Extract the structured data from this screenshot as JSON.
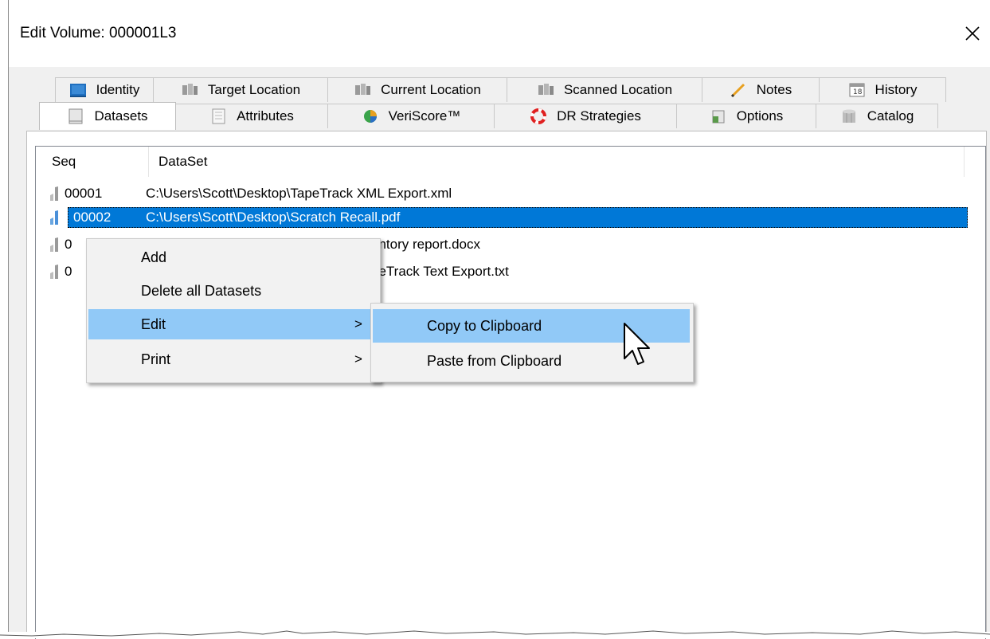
{
  "window": {
    "title": "Edit Volume: 000001L3"
  },
  "tabs_back": [
    {
      "label": "Identity",
      "icon": "identity-icon"
    },
    {
      "label": "Target Location",
      "icon": "target-location-icon"
    },
    {
      "label": "Current Location",
      "icon": "current-location-icon"
    },
    {
      "label": "Scanned Location",
      "icon": "scanned-location-icon"
    },
    {
      "label": "Notes",
      "icon": "pencil-icon"
    },
    {
      "label": "History",
      "icon": "calendar-icon"
    }
  ],
  "tabs_front": [
    {
      "label": "Datasets",
      "icon": "datasets-icon",
      "selected": true
    },
    {
      "label": "Attributes",
      "icon": "attributes-icon"
    },
    {
      "label": "VeriScore™",
      "icon": "veriscore-icon"
    },
    {
      "label": "DR Strategies",
      "icon": "lifebuoy-icon"
    },
    {
      "label": "Options",
      "icon": "options-icon"
    },
    {
      "label": "Catalog",
      "icon": "database-icon"
    }
  ],
  "list": {
    "columns": [
      "Seq",
      "DataSet"
    ],
    "rows": [
      {
        "seq": "00001",
        "path": "C:\\Users\\Scott\\Desktop\\TapeTrack XML Export.xml"
      },
      {
        "seq": "00002",
        "path": "C:\\Users\\Scott\\Desktop\\Scratch Recall.pdf",
        "selected": true
      },
      {
        "seq": "0",
        "path": "entory report.docx"
      },
      {
        "seq": "0",
        "path": "peTrack Text Export.txt"
      }
    ]
  },
  "context_menu": {
    "items": [
      "Add",
      "Delete all Datasets",
      "Edit",
      "Print"
    ],
    "hovered": "Edit",
    "submenu_arrow": ">"
  },
  "submenu": {
    "items": [
      "Copy to Clipboard",
      "Paste from Clipboard"
    ],
    "hovered": "Copy to Clipboard"
  },
  "colors": {
    "selection": "#0078d7",
    "menu_hover": "#91c9f7",
    "menu_bg": "#f2f2f2",
    "window_bg": "#f0f0f0"
  }
}
